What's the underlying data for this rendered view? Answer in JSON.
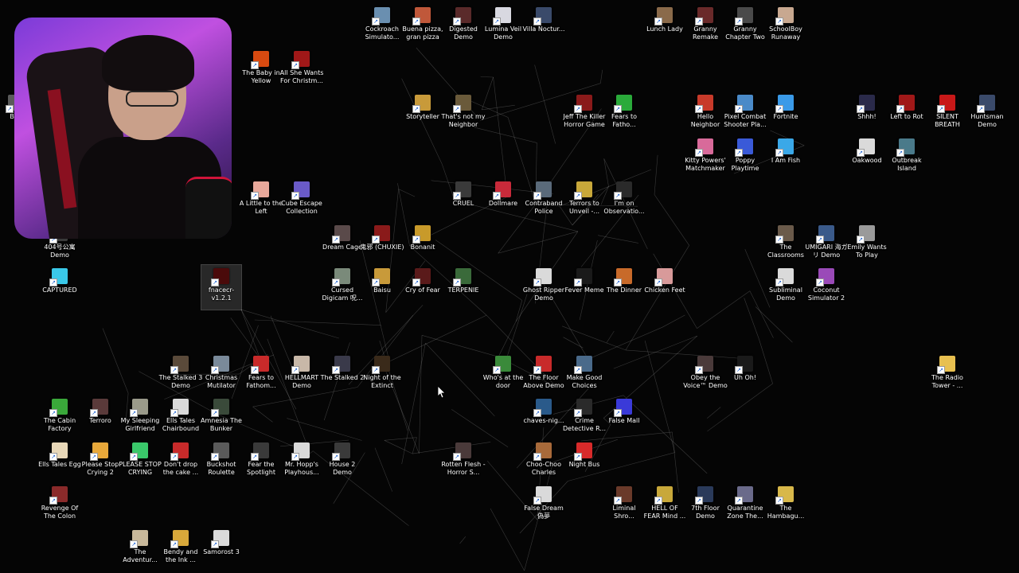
{
  "desktop": {
    "icons": [
      {
        "label": "Cockroach Simulato...",
        "color": "#6a8fb0"
      },
      {
        "label": "Buena pizza, gran pizza",
        "color": "#c0583a"
      },
      {
        "label": "Digested Demo",
        "color": "#5a2a2a"
      },
      {
        "label": "Lumina Veil Demo",
        "color": "#d8d8e0"
      },
      {
        "label": "Villa Noctur...",
        "color": "#3a4a6a"
      },
      {
        "label": "Lunch Lady",
        "color": "#8a6a4a"
      },
      {
        "label": "Granny Remake",
        "color": "#6a2a2a"
      },
      {
        "label": "Granny Chapter Two",
        "color": "#4a4a4a"
      },
      {
        "label": "SchoolBoy Runaway",
        "color": "#c8a890"
      },
      {
        "label": "The Baby in Yellow",
        "color": "#d84a10"
      },
      {
        "label": "All She Wants For Christm...",
        "color": "#a01818"
      },
      {
        "label": "Storyteller",
        "color": "#c89a3a"
      },
      {
        "label": "That's not my Neighbor",
        "color": "#6a5a3a"
      },
      {
        "label": "Jeff The Killer Horror Game",
        "color": "#8a1a1a"
      },
      {
        "label": "Fears to Fatho...",
        "color": "#2aaa3a"
      },
      {
        "label": "Hello Neighbor",
        "color": "#c83a2a"
      },
      {
        "label": "Pixel Combat Shooter Pla...",
        "color": "#4a8ac8"
      },
      {
        "label": "Fortnite",
        "color": "#3a9ae8"
      },
      {
        "label": "Shhh!",
        "color": "#2a2a4a"
      },
      {
        "label": "Left to Rot",
        "color": "#a01818"
      },
      {
        "label": "SILENT BREATH",
        "color": "#c81818"
      },
      {
        "label": "Huntsman Demo",
        "color": "#3a4a6a"
      },
      {
        "label": "Kitty Powers' Matchmaker",
        "color": "#d86a9a"
      },
      {
        "label": "Poppy Playtime",
        "color": "#3a5ad8"
      },
      {
        "label": "I Am Fish",
        "color": "#3aa8e8"
      },
      {
        "label": "Oakwood",
        "color": "#dadada"
      },
      {
        "label": "Outbreak Island",
        "color": "#4a7a8a"
      },
      {
        "label": "A Little to the Left",
        "color": "#e8a89a"
      },
      {
        "label": "Cube Escape Collection",
        "color": "#6a5ac8"
      },
      {
        "label": "CRUEL",
        "color": "#3a3a3a"
      },
      {
        "label": "Dollmare",
        "color": "#c82a3a"
      },
      {
        "label": "Contraband Police",
        "color": "#5a6a7a"
      },
      {
        "label": "Terrors to Unveil -...",
        "color": "#c8a83a"
      },
      {
        "label": "I'm on Observatio...",
        "color": "#2a2a2a"
      },
      {
        "label": "Dream Cage",
        "color": "#5a4a4a"
      },
      {
        "label": "鬼邪 (CHUXIE)",
        "color": "#8a1a1a"
      },
      {
        "label": "Bonanit",
        "color": "#c89a2a"
      },
      {
        "label": "The Classrooms",
        "color": "#6a5a4a"
      },
      {
        "label": "UMIGARI 海ガリ Demo",
        "color": "#3a5a8a"
      },
      {
        "label": "Emily Wants To Play",
        "color": "#9a9a9a"
      },
      {
        "label": "404号公寓 Demo",
        "color": "#3a3a3a"
      },
      {
        "label": "CAPTURED",
        "color": "#3ac8e8"
      },
      {
        "label": "fnacecr-v1.2.1",
        "color": "#4a0a0a"
      },
      {
        "label": "Cursed Digicam 呪...",
        "color": "#7a8a7a"
      },
      {
        "label": "Baisu",
        "color": "#c89a3a"
      },
      {
        "label": "Cry of Fear",
        "color": "#5a1a1a"
      },
      {
        "label": "TERPENIE",
        "color": "#3a6a3a"
      },
      {
        "label": "Ghost Ripper Demo",
        "color": "#dadada"
      },
      {
        "label": "Fever Meme",
        "color": "#1a1a1a"
      },
      {
        "label": "The Dinner",
        "color": "#c86a2a"
      },
      {
        "label": "Chicken Feet",
        "color": "#d89a9a"
      },
      {
        "label": "Subliminal Demo",
        "color": "#dadada"
      },
      {
        "label": "Coconut Simulator 2",
        "color": "#9a4ab8"
      },
      {
        "label": "The Stalked 3 Demo",
        "color": "#5a4a3a"
      },
      {
        "label": "Christmas Mutilator",
        "color": "#7a8a9a"
      },
      {
        "label": "Fears to Fathom...",
        "color": "#c82a2a"
      },
      {
        "label": "HELLMART Demo",
        "color": "#c8b8a8"
      },
      {
        "label": "The Stalked 2",
        "color": "#3a3a4a"
      },
      {
        "label": "Night of the Extinct",
        "color": "#3a2a1a"
      },
      {
        "label": "Who's at the door",
        "color": "#3a8a3a"
      },
      {
        "label": "The Floor Above Demo",
        "color": "#c82a2a"
      },
      {
        "label": "Make Good Choices",
        "color": "#4a6a8a"
      },
      {
        "label": "Obey the Voice™ Demo",
        "color": "#4a3a3a"
      },
      {
        "label": "Uh Oh!",
        "color": "#1a1a1a"
      },
      {
        "label": "The Radio Tower - ...",
        "color": "#e8c050"
      },
      {
        "label": "The Cabin Factory",
        "color": "#3aa83a"
      },
      {
        "label": "Terroro",
        "color": "#5a3a3a"
      },
      {
        "label": "My Sleeping Girlfriend",
        "color": "#9a9a8a"
      },
      {
        "label": "Ells Tales Chairbound",
        "color": "#dadada"
      },
      {
        "label": "Amnesia The Bunker",
        "color": "#3a4a3a"
      },
      {
        "label": "chaves-nig...",
        "color": "#2a5a8a"
      },
      {
        "label": "Crime Detective R...",
        "color": "#2a2a2a"
      },
      {
        "label": "False Mall",
        "color": "#3a3ad8"
      },
      {
        "label": "Ells Tales Egg",
        "color": "#e8d8b8"
      },
      {
        "label": "Please Stop Crying 2",
        "color": "#e8a83a"
      },
      {
        "label": "PLEASE STOP CRYING",
        "color": "#3ac86a"
      },
      {
        "label": "Don't drop the cake ...",
        "color": "#c82a2a"
      },
      {
        "label": "Buckshot Roulette",
        "color": "#5a5a5a"
      },
      {
        "label": "Fear the Spotlight",
        "color": "#3a3a3a"
      },
      {
        "label": "Mr. Hopp's Playhous...",
        "color": "#dadada"
      },
      {
        "label": "House 2 Demo",
        "color": "#3a3a3a"
      },
      {
        "label": "Rotten Flesh - Horror S...",
        "color": "#4a3a3a"
      },
      {
        "label": "Choo-Choo Charles",
        "color": "#a86a3a"
      },
      {
        "label": "Night Bus",
        "color": "#d82a2a"
      },
      {
        "label": "Revenge Of The Colon",
        "color": "#8a2a2a"
      },
      {
        "label": "False Dream 偽夢",
        "color": "#dadada"
      },
      {
        "label": "Liminal Shro...",
        "color": "#6a3a2a"
      },
      {
        "label": "HELL OF FEAR Mind ...",
        "color": "#c8a83a"
      },
      {
        "label": "7th Floor Demo",
        "color": "#2a3a5a"
      },
      {
        "label": "Quarantine Zone The...",
        "color": "#6a6a8a"
      },
      {
        "label": "The Hambagu...",
        "color": "#d8b84a"
      },
      {
        "label": "The Adventur...",
        "color": "#c8b89a"
      },
      {
        "label": "Bendy and the Ink ...",
        "color": "#d8a83a"
      },
      {
        "label": "Samorost 3",
        "color": "#dadada"
      },
      {
        "label": "Boo",
        "color": "#5a5a5a"
      }
    ]
  }
}
